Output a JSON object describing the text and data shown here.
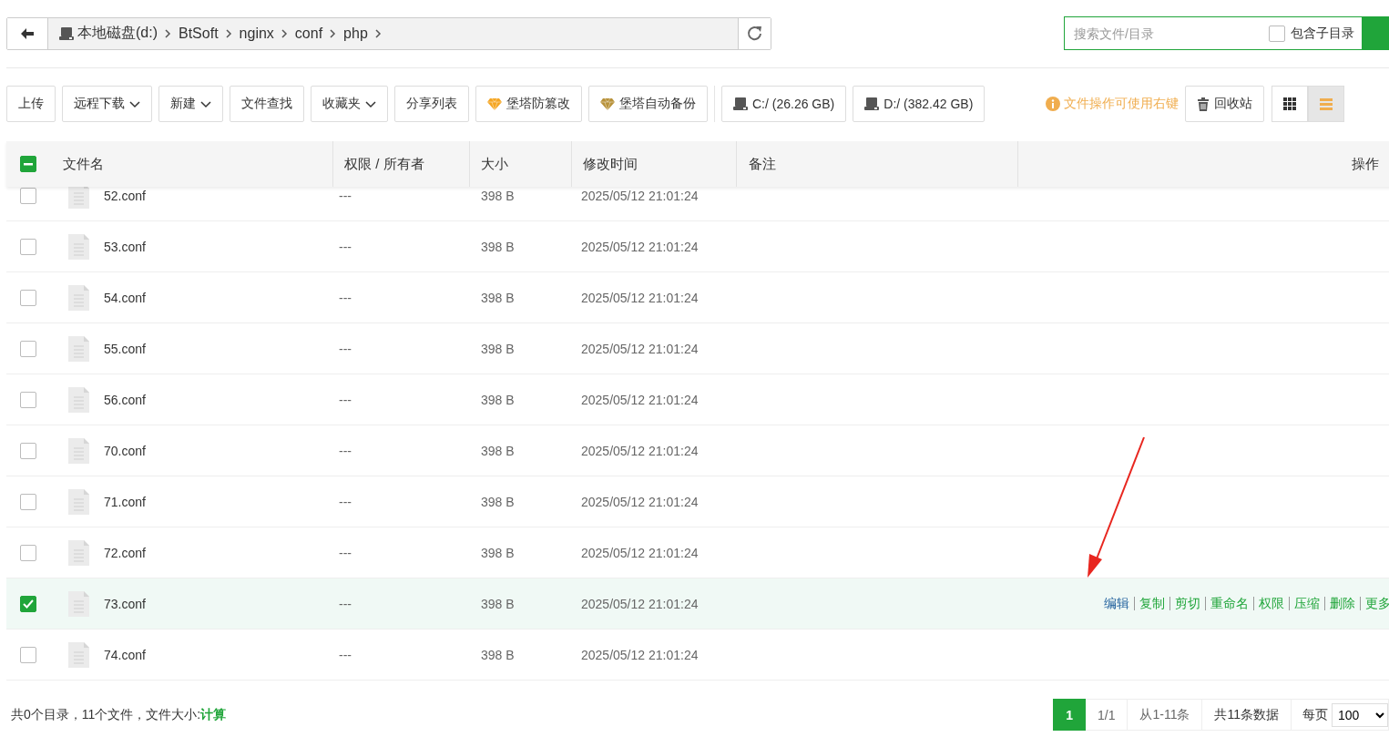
{
  "nav": {
    "breadcrumbs": [
      {
        "label": "本地磁盘(d:)",
        "kind": "drive"
      },
      {
        "label": "BtSoft",
        "kind": "folder"
      },
      {
        "label": "nginx",
        "kind": "folder"
      },
      {
        "label": "conf",
        "kind": "folder"
      },
      {
        "label": "php",
        "kind": "folder"
      }
    ]
  },
  "search": {
    "placeholder": "搜索文件/目录",
    "include_subdirs": {
      "label": "包含子目录",
      "checked": false
    }
  },
  "toolbar": {
    "buttons": [
      {
        "label": "上传",
        "kind": "plain"
      },
      {
        "label": "远程下载",
        "kind": "dropdown"
      },
      {
        "label": "新建",
        "kind": "dropdown"
      },
      {
        "label": "文件查找",
        "kind": "plain"
      },
      {
        "label": "收藏夹",
        "kind": "dropdown"
      },
      {
        "label": "分享列表",
        "kind": "plain"
      },
      {
        "label": "堡塔防篡改",
        "kind": "gem",
        "color": "#f5a623"
      },
      {
        "label": "堡塔自动备份",
        "kind": "gem",
        "color": "#b8923a"
      },
      {
        "label": "C:/ (26.26 GB)",
        "kind": "drive"
      },
      {
        "label": "D:/ (382.42 GB)",
        "kind": "drive"
      }
    ],
    "hint": "文件操作可使用右键",
    "recycle": "回收站",
    "views": [
      {
        "kind": "grid",
        "selected": false
      },
      {
        "kind": "list",
        "selected": true
      }
    ]
  },
  "table": {
    "select_all": {
      "indeterminate": true
    },
    "columns": [
      "文件名",
      "权限 / 所有者",
      "大小",
      "修改时间",
      "备注",
      "操作"
    ],
    "rows": [
      {
        "name": "52.conf",
        "perm": "---",
        "size": "398 B",
        "mtime": "2025/05/12 21:01:24",
        "selected": false
      },
      {
        "name": "53.conf",
        "perm": "---",
        "size": "398 B",
        "mtime": "2025/05/12 21:01:24",
        "selected": false
      },
      {
        "name": "54.conf",
        "perm": "---",
        "size": "398 B",
        "mtime": "2025/05/12 21:01:24",
        "selected": false
      },
      {
        "name": "55.conf",
        "perm": "---",
        "size": "398 B",
        "mtime": "2025/05/12 21:01:24",
        "selected": false
      },
      {
        "name": "56.conf",
        "perm": "---",
        "size": "398 B",
        "mtime": "2025/05/12 21:01:24",
        "selected": false
      },
      {
        "name": "70.conf",
        "perm": "---",
        "size": "398 B",
        "mtime": "2025/05/12 21:01:24",
        "selected": false
      },
      {
        "name": "71.conf",
        "perm": "---",
        "size": "398 B",
        "mtime": "2025/05/12 21:01:24",
        "selected": false
      },
      {
        "name": "72.conf",
        "perm": "---",
        "size": "398 B",
        "mtime": "2025/05/12 21:01:24",
        "selected": false
      },
      {
        "name": "73.conf",
        "perm": "---",
        "size": "398 B",
        "mtime": "2025/05/12 21:01:24",
        "selected": true,
        "actions": [
          {
            "label": "编辑",
            "hovered": true
          },
          {
            "label": "复制",
            "hovered": false
          },
          {
            "label": "剪切",
            "hovered": false
          },
          {
            "label": "重命名",
            "hovered": false
          },
          {
            "label": "权限",
            "hovered": false
          },
          {
            "label": "压缩",
            "hovered": false
          },
          {
            "label": "删除",
            "hovered": false
          },
          {
            "label": "更多",
            "hovered": false
          }
        ]
      },
      {
        "name": "74.conf",
        "perm": "---",
        "size": "398 B",
        "mtime": "2025/05/12 21:01:24",
        "selected": false
      }
    ]
  },
  "footer": {
    "summary": "共0个目录，11个文件，文件大小: ",
    "calc_link": "计算",
    "pagination": {
      "pages": [
        {
          "label": "1",
          "selected": true
        }
      ],
      "page_info": "1/1",
      "range": "从1-11条",
      "total": "共11条数据",
      "per_page_label": "每页",
      "per_page": "100"
    }
  }
}
